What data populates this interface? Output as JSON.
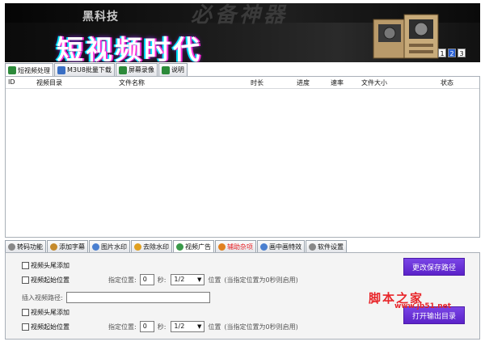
{
  "banner": {
    "subtitle": "黑科技",
    "ghost_text": "必备神器",
    "headline": "短视频时代",
    "pager": [
      "1",
      "2",
      "3"
    ],
    "pager_active": "2"
  },
  "top_tabs": [
    {
      "label": "短视频处理",
      "icon": "video-icon",
      "color": "#2c8a3a",
      "active": true
    },
    {
      "label": "M3U8批量下载",
      "icon": "download-icon",
      "color": "#3a6fc4",
      "active": false
    },
    {
      "label": "屏幕录像",
      "icon": "screen-record-icon",
      "color": "#2c8a3a",
      "active": false
    },
    {
      "label": "说明",
      "icon": "help-icon",
      "color": "#2c8a3a",
      "active": false
    }
  ],
  "list_columns": [
    "ID",
    "视频目录",
    "文件名称",
    "时长",
    "进度",
    "速率",
    "文件大小",
    "状态"
  ],
  "bottom_tabs": [
    {
      "label": "转码功能",
      "icon": "transcode-icon",
      "color": "#888888",
      "active": false
    },
    {
      "label": "添加字幕",
      "icon": "subtitle-icon",
      "color": "#c58a2c",
      "active": false
    },
    {
      "label": "图片水印",
      "icon": "image-watermark-icon",
      "color": "#4a7fd0",
      "active": false
    },
    {
      "label": "去除水印",
      "icon": "remove-watermark-icon",
      "color": "#e0a020",
      "active": false
    },
    {
      "label": "视频广告",
      "icon": "video-ad-icon",
      "color": "#3a9a4a",
      "active": true
    },
    {
      "label": "辅助杂项",
      "icon": "misc-icon",
      "color": "#e08020",
      "active": false,
      "highlight": "#e8262a"
    },
    {
      "label": "画中画特效",
      "icon": "pip-icon",
      "color": "#4a7fd0",
      "active": false
    },
    {
      "label": "软件设置",
      "icon": "settings-icon",
      "color": "#888888",
      "active": false
    }
  ],
  "panel": {
    "head_add": "视频头尾添加",
    "start_pos": "视频起始位置",
    "specify_pos": "指定位置:",
    "seconds": "秒:",
    "position": "位置",
    "hint": "(当指定位置为0秒则启用)",
    "insert_path": "插入视频路径:",
    "num1": "0",
    "sel1": "1/2",
    "num2": "0",
    "sel2": "1/2",
    "btn_save_path": "更改保存路径",
    "btn_open_dir": "打开输出目录"
  },
  "watermark": {
    "text": "脚本之家",
    "url": "www.jb51.net"
  }
}
